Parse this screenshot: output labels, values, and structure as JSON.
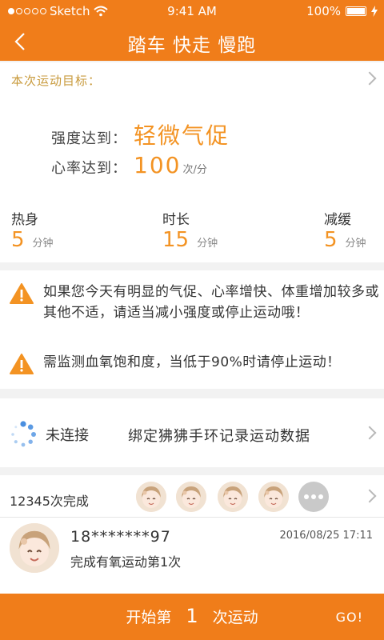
{
  "status_bar": {
    "carrier": "Sketch",
    "time": "9:41 AM",
    "battery": "100%"
  },
  "nav": {
    "title": "踏车 快走 慢跑"
  },
  "goal": {
    "heading": "本次运动目标：",
    "intensity_label": "强度达到：",
    "intensity_value": "轻微气促",
    "heart_label": "心率达到：",
    "heart_value": "100",
    "heart_unit": "次/分",
    "phases": [
      {
        "label": "热身",
        "value": "5",
        "unit": "分钟"
      },
      {
        "label": "时长",
        "value": "15",
        "unit": "分钟"
      },
      {
        "label": "减缓",
        "value": "5",
        "unit": "分钟"
      }
    ]
  },
  "warnings": [
    {
      "text": "如果您今天有明显的气促、心率增快、体重增加较多或其他不适，请适当减小强度或停止运动哦！"
    },
    {
      "text": "需监测血氧饱和度，当低于90%时请停止运动！"
    }
  ],
  "device": {
    "status": "未连接",
    "action": "绑定狒狒手环记录运动数据"
  },
  "completions": {
    "count": "12345次完成",
    "record": {
      "name": "18*******97",
      "date": "2016/08/25 17:11",
      "desc": "完成有氧运动第1次"
    }
  },
  "bottom": {
    "start_prefix": "开始第",
    "start_num": "1",
    "start_suffix": "次运动",
    "go": "GO!"
  },
  "colors": {
    "accent": "#f07d1a",
    "value": "#f39323",
    "goal_label": "#c89a3c"
  },
  "icons": [
    "back-arrow-icon",
    "wifi-icon",
    "battery-icon",
    "charging-icon",
    "chevron-right-icon",
    "warning-icon",
    "loading-spinner-icon",
    "more-icon"
  ]
}
